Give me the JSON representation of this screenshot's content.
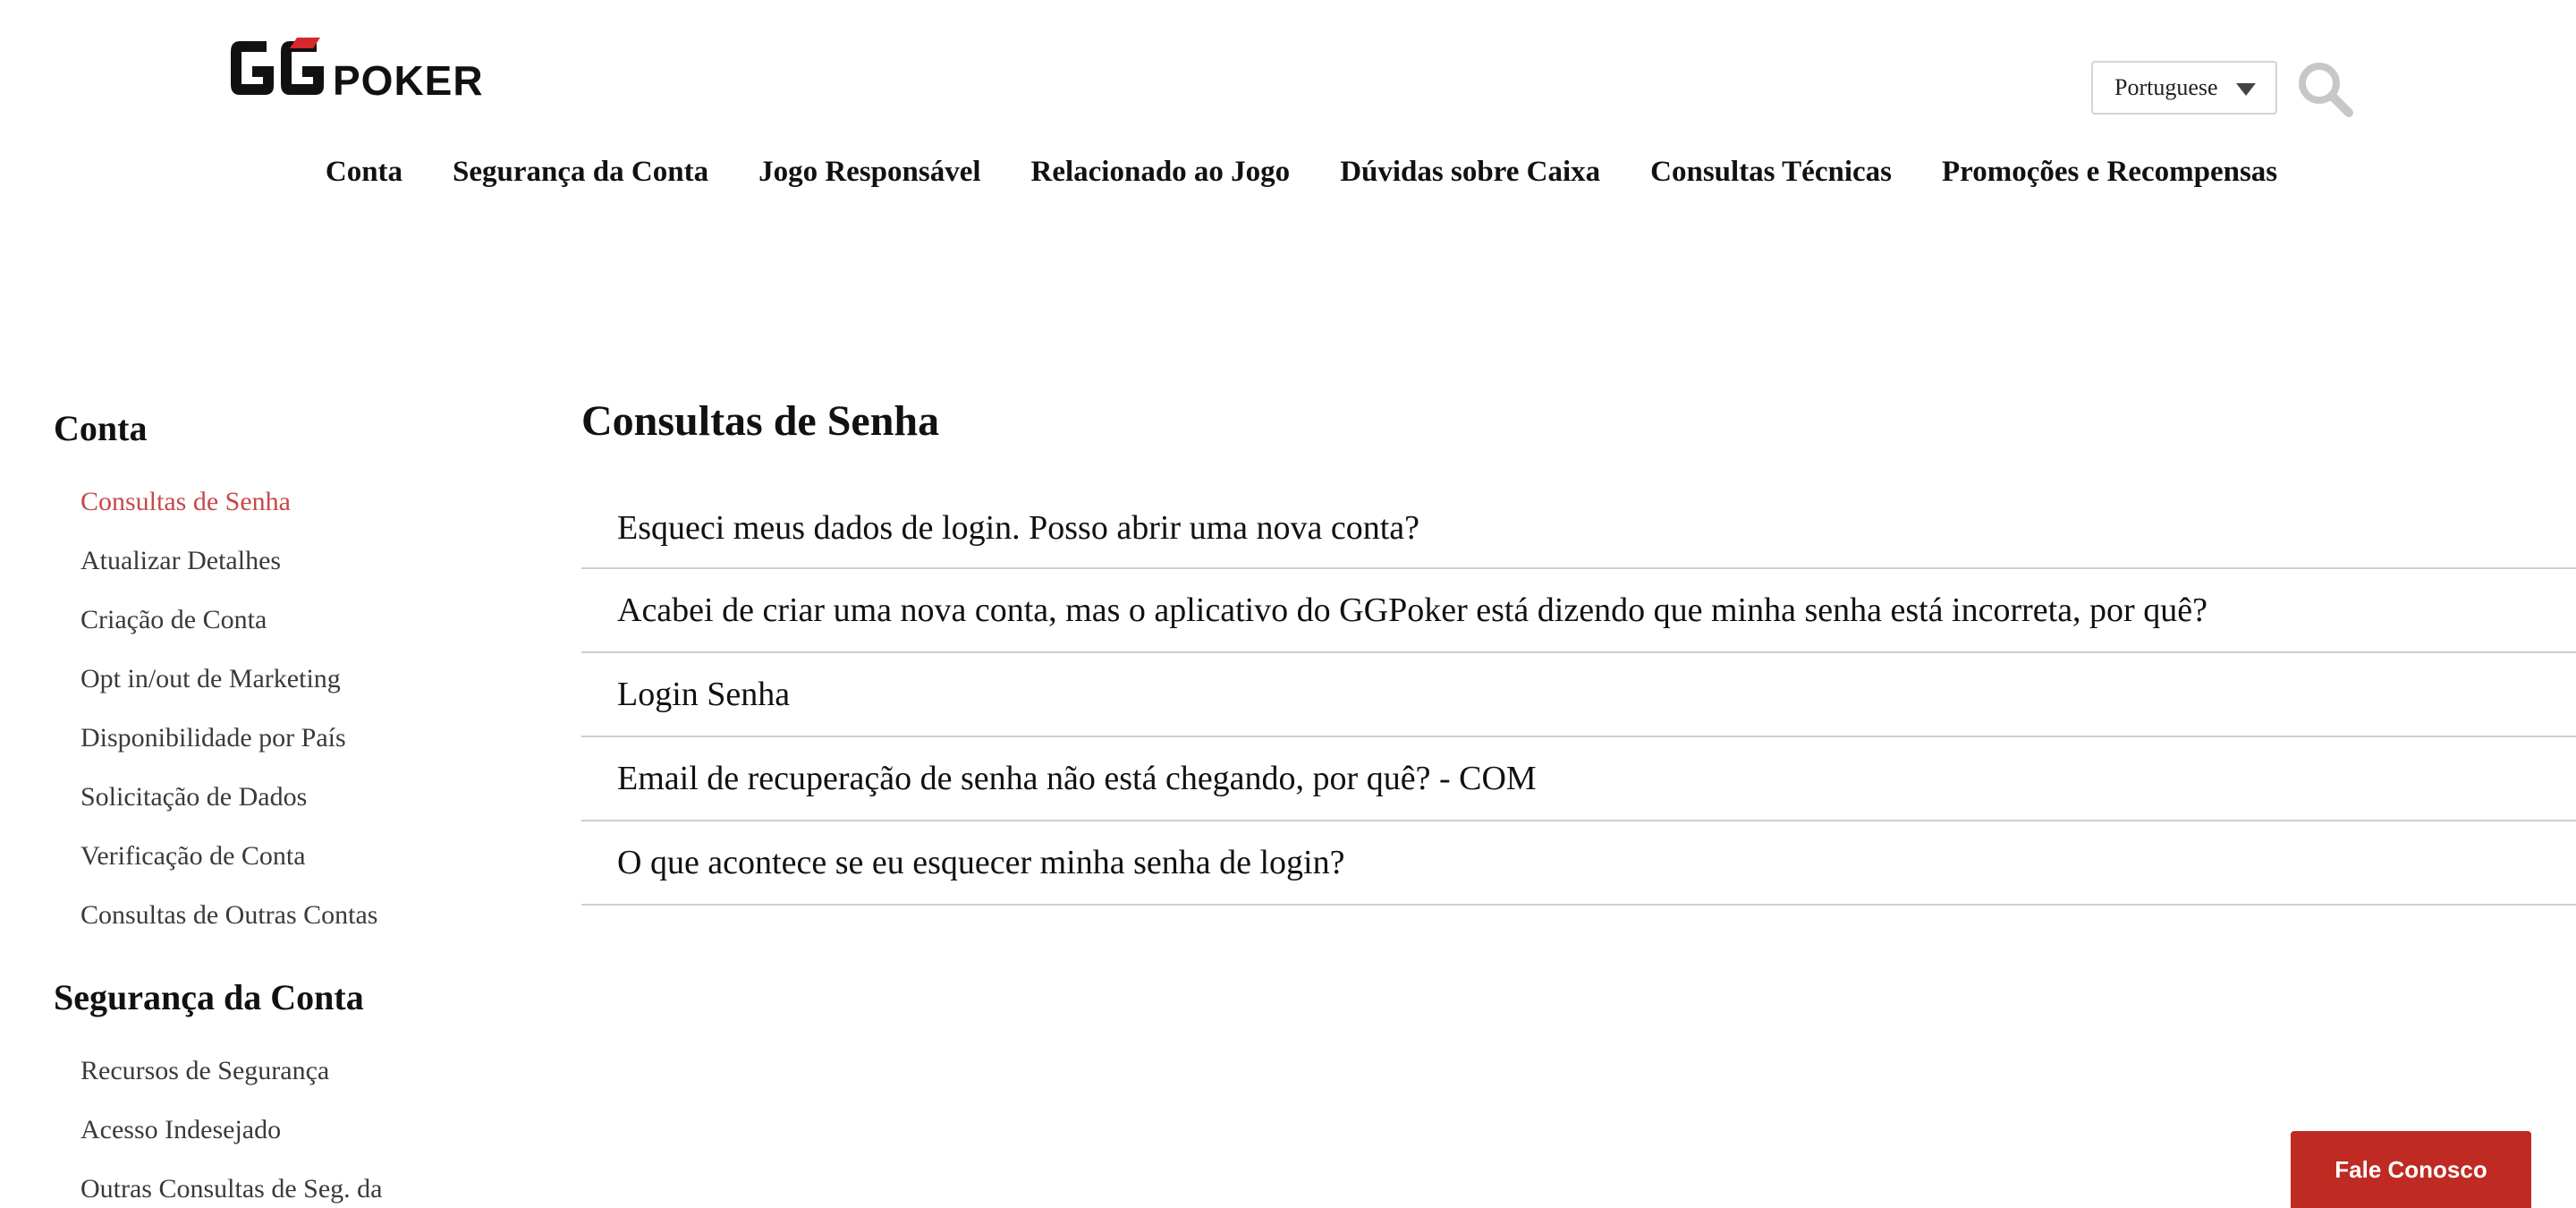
{
  "header": {
    "logo_text_gg": "GG",
    "logo_text_poker": "POKER",
    "language_selected": "Portuguese",
    "nav": [
      "Conta",
      "Segurança da Conta",
      "Jogo Responsável",
      "Relacionado ao Jogo",
      "Dúvidas sobre Caixa",
      "Consultas Técnicas",
      "Promoções e Recompensas"
    ]
  },
  "sidebar": {
    "groups": [
      {
        "title": "Conta",
        "items": [
          "Consultas de Senha",
          "Atualizar Detalhes",
          "Criação de Conta",
          "Opt in/out de Marketing",
          "Disponibilidade por País",
          "Solicitação de Dados",
          "Verificação de Conta",
          "Consultas de Outras Contas"
        ]
      },
      {
        "title": "Segurança da Conta",
        "items": [
          "Recursos de Segurança",
          "Acesso Indesejado",
          "Outras Consultas de Seg. da"
        ]
      }
    ]
  },
  "main": {
    "title": "Consultas de Senha",
    "articles": [
      "Esqueci meus dados de login. Posso abrir uma nova conta?",
      "Acabei de criar uma nova conta, mas o aplicativo do GGPoker está dizendo que minha senha está incorreta, por quê?",
      "Login Senha",
      "Email de recuperação de senha não está chegando, por quê? - COM",
      "O que acontece se eu esquecer minha senha de login?"
    ]
  },
  "contact_button": "Fale Conosco",
  "colors": {
    "accent_red": "#c84848",
    "button_red": "#bf2a22",
    "divider": "#cfcfcf",
    "logo_red": "#d6282d"
  },
  "icons": {
    "search": "search-icon",
    "dropdown": "chevron-down-icon"
  }
}
